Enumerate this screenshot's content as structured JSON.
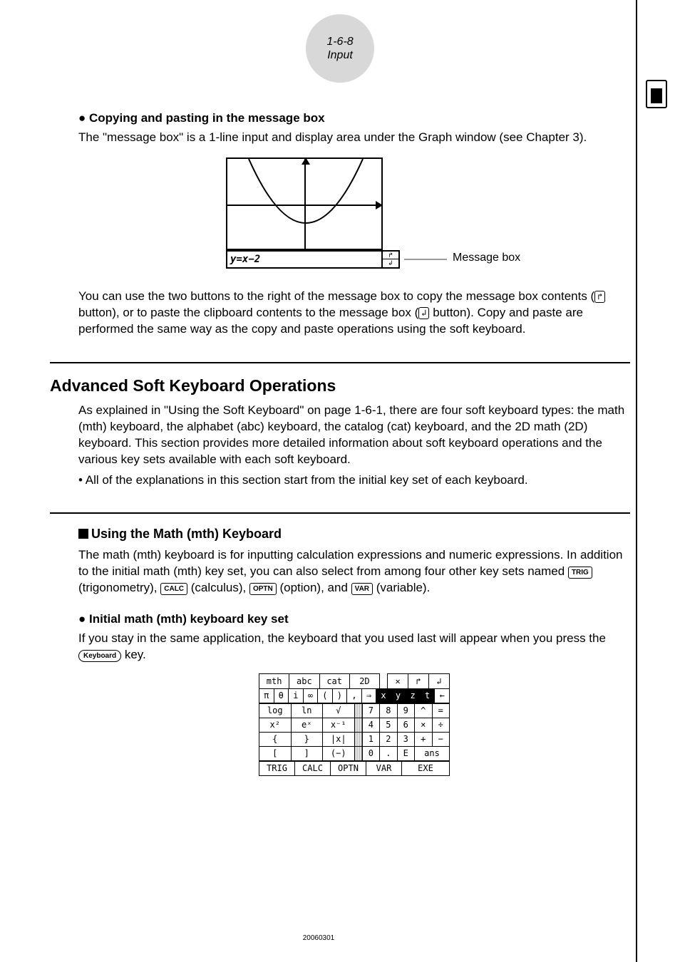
{
  "header": {
    "page_ref": "1-6-8",
    "section": "Input"
  },
  "s1": {
    "title": "● Copying and pasting in the message box",
    "p1": "The \"message box\" is a 1-line input and display area under the Graph window (see Chapter 3).",
    "figure": {
      "expr": "y=x−2",
      "label": "Message box"
    },
    "p2a": "You can use the two buttons to the right of the message box to copy the message box contents (",
    "p2b": " button), or to paste the clipboard contents to the message box (",
    "p2c": " button). Copy and paste are performed the same way as the copy and paste operations using the soft keyboard.",
    "copy_icon": "↱",
    "paste_icon": "↲"
  },
  "s2": {
    "title": "Advanced Soft Keyboard Operations",
    "p1": "As explained in \"Using the Soft Keyboard\" on page 1-6-1, there are four soft keyboard types: the math (mth) keyboard, the alphabet (abc) keyboard, the catalog (cat) keyboard, and the 2D math (2D) keyboard.  This section provides more detailed information about soft keyboard operations and the various key sets available with each soft keyboard.",
    "p2": "• All of the explanations in this section start from the initial key set of each keyboard."
  },
  "s3": {
    "title": "Using the Math (mth) Keyboard",
    "p1a": "The math (mth) keyboard is for inputting calculation expressions and numeric expressions. In addition to the initial math (mth) key set, you can also select from among four other key sets named ",
    "trig": "TRIG",
    "p1b": " (trigonometry), ",
    "calc": "CALC",
    "p1c": " (calculus), ",
    "optn": "OPTN",
    "p1d": " (option), and ",
    "var": "VAR",
    "p1e": " (variable)."
  },
  "s4": {
    "title": "● Initial math (mth) keyboard key set",
    "p1a": "If you stay in the same application, the keyboard that you used last will appear when you press the ",
    "kb_key": "Keyboard",
    "p1b": " key."
  },
  "kb": {
    "tabs": [
      "mth",
      "abc",
      "cat",
      "2D"
    ],
    "tab_icons": [
      "✕",
      "↱",
      "↲"
    ],
    "row1": [
      "π",
      "θ",
      "i",
      "∞",
      "(",
      ")",
      ",",
      "⇒",
      "x",
      "y",
      "z",
      "t",
      "←"
    ],
    "rows": [
      [
        "log",
        "ln",
        "√",
        "",
        "7",
        "8",
        "9",
        "^",
        "="
      ],
      [
        "x²",
        "eˣ",
        "x⁻¹",
        "",
        "4",
        "5",
        "6",
        "×",
        "÷"
      ],
      [
        "{",
        "}",
        "|x|",
        "",
        "1",
        "2",
        "3",
        "+",
        "−"
      ],
      [
        "[",
        "]",
        "(−)",
        "",
        "0",
        ".",
        "E",
        "ans",
        ""
      ]
    ],
    "bottom": [
      "TRIG",
      "CALC",
      "OPTN",
      "VAR",
      "EXE"
    ]
  },
  "footer": {
    "code": "20060301"
  }
}
